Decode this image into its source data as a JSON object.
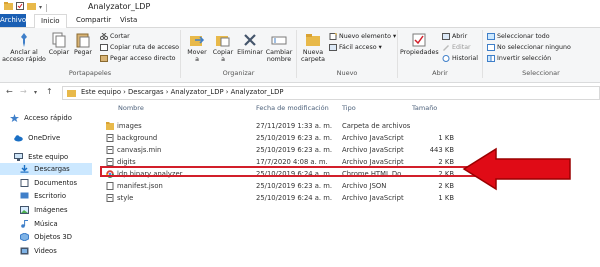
{
  "window": {
    "title": "Analyzator_LDP"
  },
  "tabs": [
    {
      "label": "Archivo"
    },
    {
      "label": "Inicio"
    },
    {
      "label": "Compartir"
    },
    {
      "label": "Vista"
    }
  ],
  "ribbon": {
    "portapapeles": {
      "label": "Portapapeles",
      "anclar": "Anclar al acceso rápido",
      "copiar": "Copiar",
      "pegar": "Pegar",
      "cortar": "Cortar",
      "copiar_ruta": "Copiar ruta de acceso",
      "pegar_acceso": "Pegar acceso directo"
    },
    "organizar": {
      "label": "Organizar",
      "mover": "Mover a",
      "copiar": "Copiar a",
      "eliminar": "Eliminar",
      "cambiar": "Cambiar nombre"
    },
    "nuevo": {
      "label": "Nuevo",
      "nueva_carpeta": "Nueva carpeta",
      "nuevo_elemento": "Nuevo elemento",
      "facil_acceso": "Fácil acceso"
    },
    "abrir": {
      "label": "Abrir",
      "propiedades": "Propiedades",
      "abrir": "Abrir",
      "editar": "Editar",
      "historial": "Historial"
    },
    "seleccionar": {
      "label": "Seleccionar",
      "todo": "Seleccionar todo",
      "ninguno": "No seleccionar ninguno",
      "invertir": "Invertir selección"
    }
  },
  "address": {
    "crumbs": "Este equipo  ›  Descargas  ›  Analyzator_LDP  ›  Analyzator_LDP"
  },
  "sidebar": {
    "items": [
      {
        "label": "Acceso rápido"
      },
      {
        "label": "OneDrive"
      },
      {
        "label": "Este equipo"
      },
      {
        "label": "Descargas"
      },
      {
        "label": "Documentos"
      },
      {
        "label": "Escritorio"
      },
      {
        "label": "Imágenes"
      },
      {
        "label": "Música"
      },
      {
        "label": "Objetos 3D"
      },
      {
        "label": "Videos"
      }
    ]
  },
  "columns": {
    "name": "Nombre",
    "date": "Fecha de modificación",
    "type": "Tipo",
    "size": "Tamaño"
  },
  "files": [
    {
      "name": "images",
      "date": "27/11/2019 1:33 a. m.",
      "type": "Carpeta de archivos",
      "size": "",
      "icon": "folder-icon"
    },
    {
      "name": "background",
      "date": "25/10/2019 6:23 a. m.",
      "type": "Archivo JavaScript",
      "size": "1 KB",
      "icon": "js-file-icon"
    },
    {
      "name": "canvasjs.min",
      "date": "25/10/2019 6:23 a. m.",
      "type": "Archivo JavaScript",
      "size": "443 KB",
      "icon": "js-file-icon"
    },
    {
      "name": "digits",
      "date": "17/7/2020 4:08 a. m.",
      "type": "Archivo JavaScript",
      "size": "2 KB",
      "icon": "js-file-icon"
    },
    {
      "name": "ldp binary analyzer",
      "date": "25/10/2019 6:24 a. m.",
      "type": "Chrome HTML Do...",
      "size": "2 KB",
      "icon": "chrome-icon"
    },
    {
      "name": "manifest.json",
      "date": "25/10/2019 6:23 a. m.",
      "type": "Archivo JSON",
      "size": "2 KB",
      "icon": "json-file-icon"
    },
    {
      "name": "style",
      "date": "25/10/2019 6:24 a. m.",
      "type": "Archivo JavaScript",
      "size": "1 KB",
      "icon": "js-file-icon"
    }
  ],
  "colors": {
    "accent": "#1a5fb4",
    "highlight": "#d21f2a",
    "arrow": "#e00b16"
  }
}
